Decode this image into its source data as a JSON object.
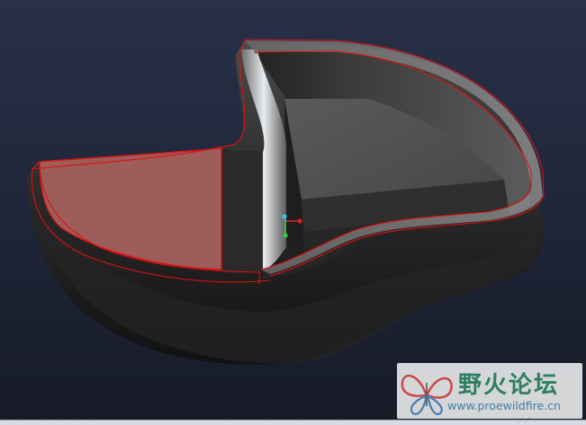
{
  "viewport": {
    "background_top": "#273049",
    "background_bottom": "#171b28",
    "model_edge_color": "#e01010",
    "selected_face_color": "#9c5d5b",
    "axis_colors": {
      "x": "#e02020",
      "y": "#30d040",
      "z": "#30c8e8"
    }
  },
  "watermark": {
    "logo_icon": "butterfly-logo-icon",
    "title": "野火论坛",
    "url": "www.proewildfire.cn"
  }
}
